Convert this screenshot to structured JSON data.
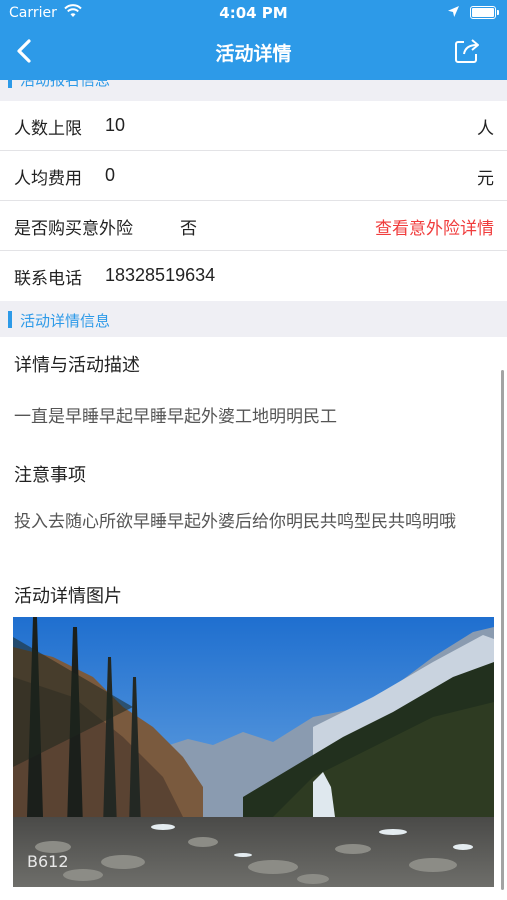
{
  "status_bar": {
    "carrier": "Carrier",
    "time": "4:04 PM"
  },
  "nav": {
    "title": "活动详情",
    "icons": {
      "back": "chevron-left-icon",
      "share": "share-edit-icon"
    }
  },
  "signup_section": {
    "header": "活动报名信息",
    "rows": {
      "limit": {
        "label": "人数上限",
        "value": "10",
        "unit": "人"
      },
      "fee": {
        "label": "人均费用",
        "value": "0",
        "unit": "元"
      },
      "insurance": {
        "label": "是否购买意外险",
        "value": "否",
        "link": "查看意外险详情"
      },
      "phone": {
        "label": "联系电话",
        "value": "18328519634"
      }
    }
  },
  "detail_section": {
    "header": "活动详情信息",
    "description_title": "详情与活动描述",
    "description": "一直是早睡早起早睡早起外婆工地明明民工",
    "notes_title": "注意事项",
    "notes": "投入去随心所欲早睡早起外婆后给你明民共鸣型民共鸣明哦",
    "images_title": "活动详情图片",
    "image_watermark": "B612"
  },
  "colors": {
    "accent": "#2d9ae8",
    "link_red": "#f03c3c",
    "background": "#efeff4"
  }
}
